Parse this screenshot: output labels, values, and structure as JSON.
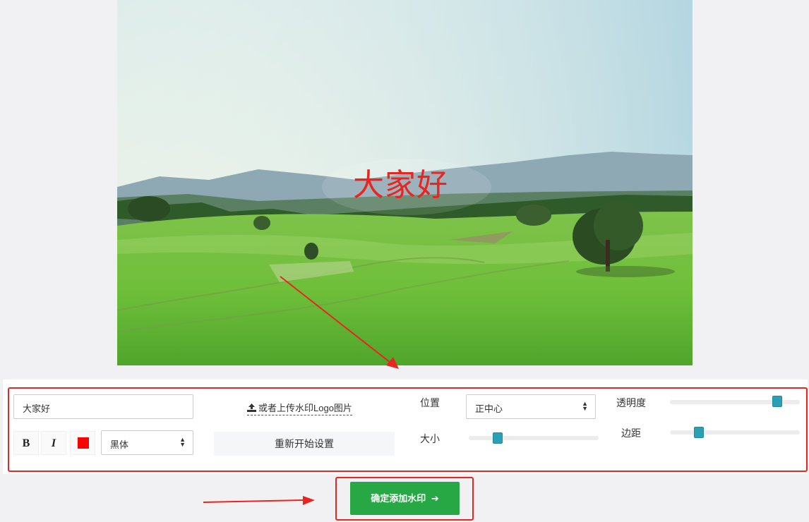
{
  "preview": {
    "watermark_text": "大家好",
    "watermark_color": "#e8251f"
  },
  "controls": {
    "text_input_value": "大家好",
    "bold_label": "B",
    "italic_label": "I",
    "color_value": "#ff0000",
    "font_select_value": "黑体",
    "upload_label": "或者上传水印Logo图片",
    "reset_label": "重新开始设置",
    "position_label": "位置",
    "position_select_value": "正中心",
    "size_label": "大小",
    "size_value": 0.2,
    "opacity_label": "透明度",
    "opacity_value": 0.85,
    "margin_label": "边距",
    "margin_value": 0.2
  },
  "confirm_label": "确定添加水印",
  "accent_color": "#28a745",
  "annotation_color": "#e8251f"
}
